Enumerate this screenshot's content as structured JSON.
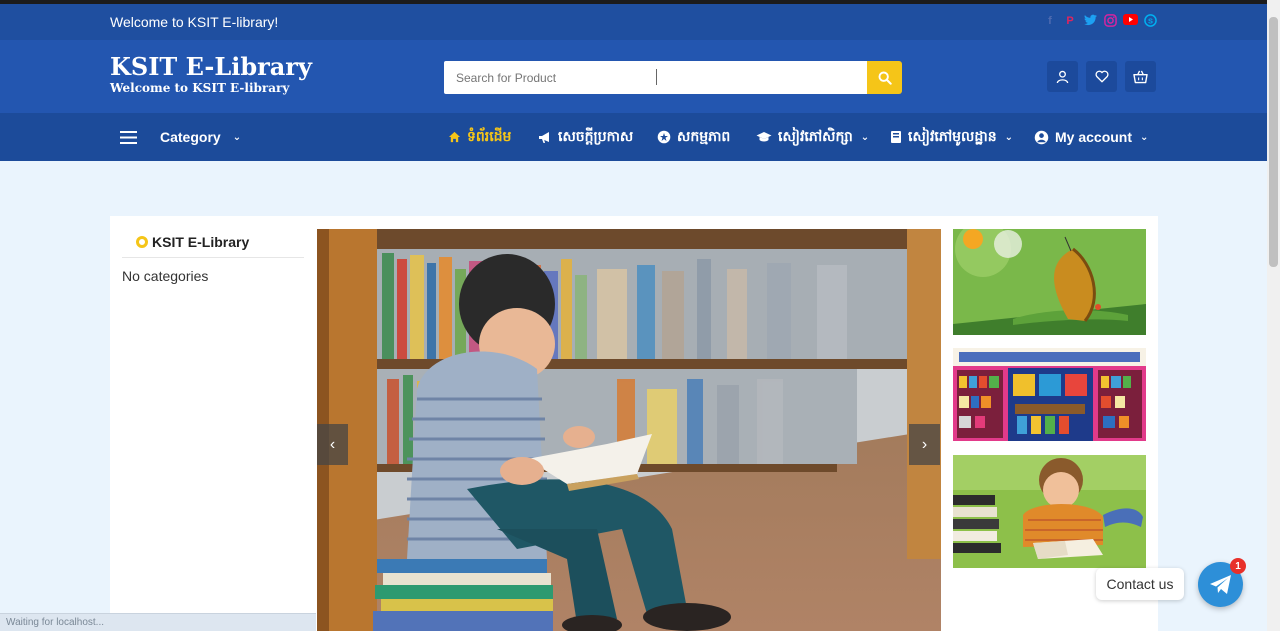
{
  "topbar": {
    "welcome": "Welcome to KSIT E-library!",
    "social": [
      {
        "icon": "facebook-icon",
        "glyph": "f",
        "color": "#4f6bb0"
      },
      {
        "icon": "pinterest-icon",
        "glyph": "P",
        "color": "#e0245e"
      },
      {
        "icon": "twitter-icon",
        "glyph": "t",
        "color": "#1da1f2"
      },
      {
        "icon": "instagram-icon",
        "glyph": "◎",
        "color": "#d6249f"
      },
      {
        "icon": "youtube-icon",
        "glyph": "▶",
        "color": "#ff0000"
      },
      {
        "icon": "skype-icon",
        "glyph": "S",
        "color": "#00aff0"
      }
    ]
  },
  "header": {
    "brand_title": "KSIT E-Library",
    "brand_subtitle": "Welcome to KSIT E-library",
    "search_placeholder": "Search for Product"
  },
  "nav": {
    "category_label": "Category",
    "items": [
      {
        "label": "ទំព័រដើម",
        "icon": "home-icon",
        "active": true
      },
      {
        "label": "សេចក្តីប្រកាស",
        "icon": "megaphone-icon"
      },
      {
        "label": "សកម្មភាព",
        "icon": "activity-icon"
      },
      {
        "label": "សៀវភៅសិក្សា",
        "icon": "graduation-cap-icon",
        "dropdown": true
      },
      {
        "label": "សៀវភៅមូលដ្ឋាន",
        "icon": "book-icon",
        "dropdown": true
      },
      {
        "label": "My account",
        "icon": "user-circle-icon",
        "dropdown": true
      }
    ]
  },
  "sidebar": {
    "title": "KSIT E-Library",
    "empty_text": "No categories"
  },
  "contact": {
    "label": "Contact us",
    "badge": "1"
  },
  "status": "Waiting for localhost...",
  "colors": {
    "brand_blue": "#2356b0",
    "nav_blue": "#1c4b9a",
    "accent_yellow": "#f5c518",
    "page_bg": "#eaf4fd"
  }
}
